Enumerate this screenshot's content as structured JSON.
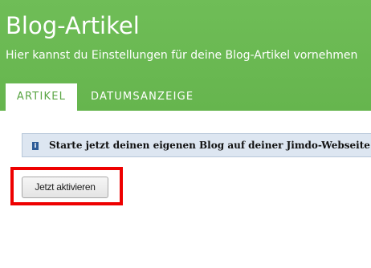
{
  "header": {
    "title": "Blog-Artikel",
    "subtitle": "Hier kannst du Einstellungen für deine Blog-Artikel vornehmen"
  },
  "tabs": [
    {
      "label": "ARTIKEL",
      "active": true
    },
    {
      "label": "DATUMSANZEIGE",
      "active": false
    }
  ],
  "notice": {
    "icon": "info-icon",
    "text": "Starte jetzt deinen eigenen Blog auf deiner Jimdo-Webseite!"
  },
  "activate_button": {
    "label": "Jetzt aktivieren"
  },
  "colors": {
    "header_green": "#6fbd57",
    "tab_text_green": "#5aa544",
    "notice_bg": "#dde6f1",
    "highlight_red": "#ee0000"
  }
}
